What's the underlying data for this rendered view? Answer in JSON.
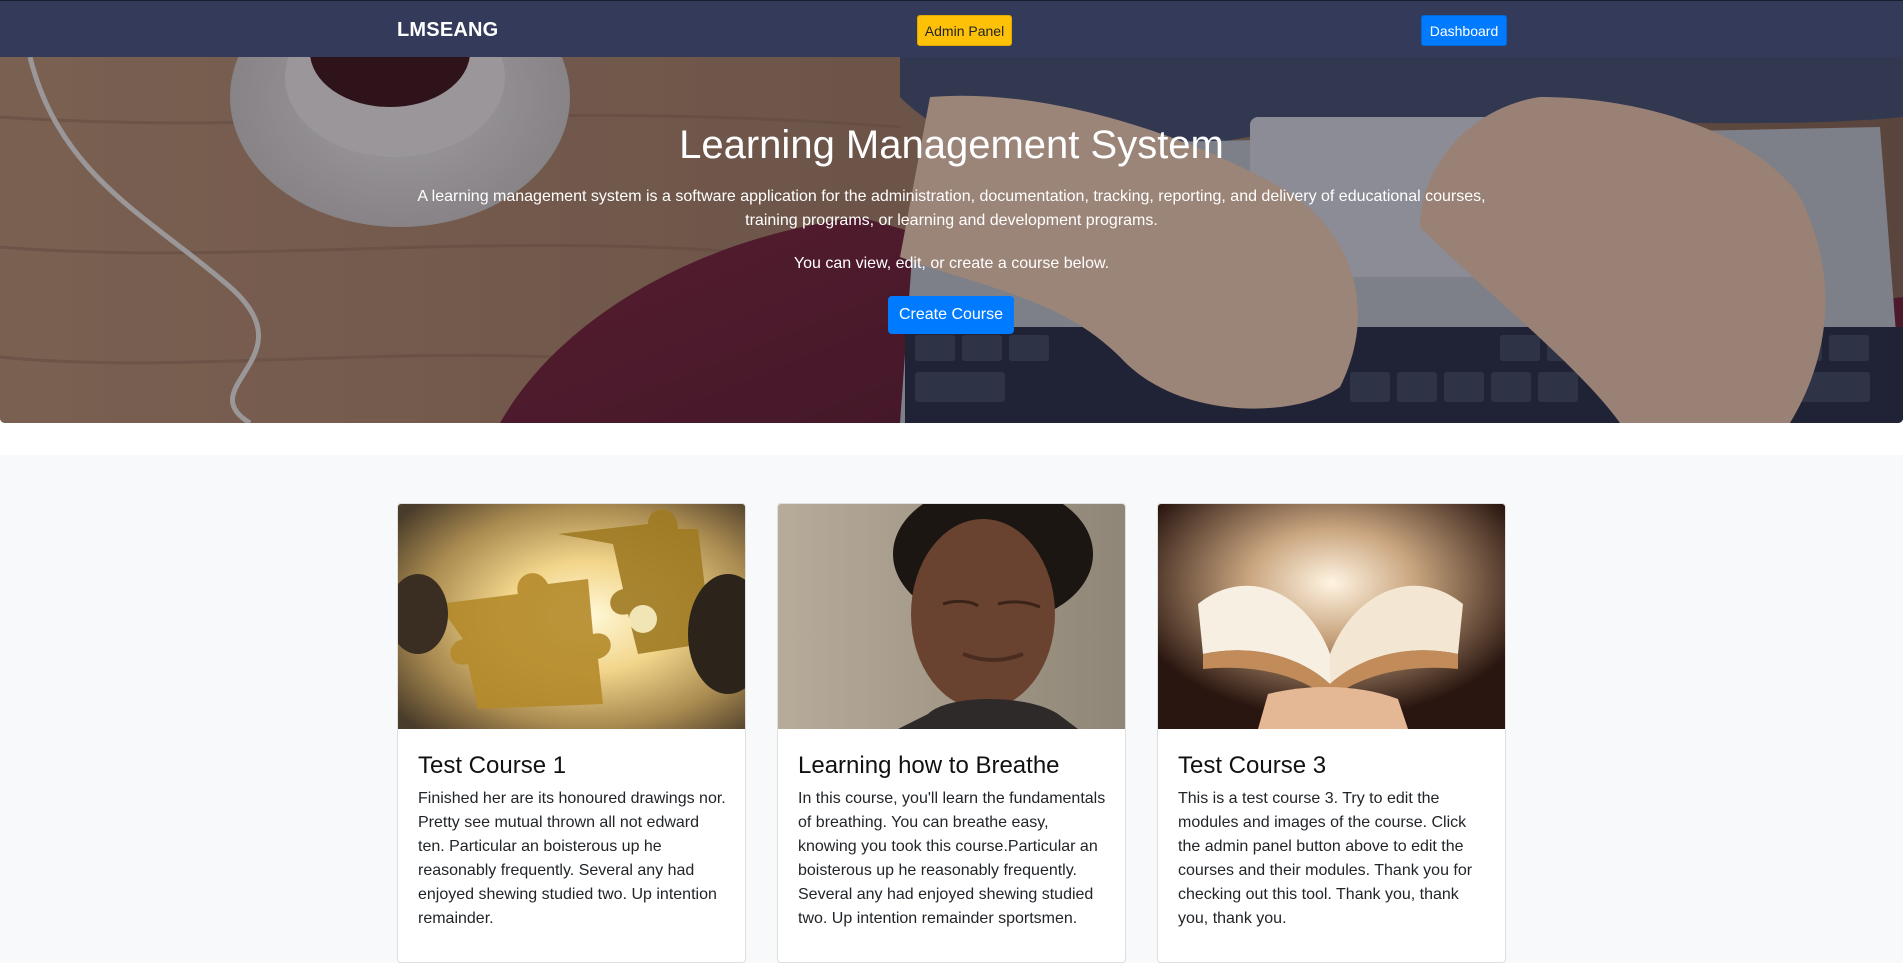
{
  "navbar": {
    "brand": "LMSEANG",
    "admin_label": "Admin Panel",
    "dashboard_label": "Dashboard"
  },
  "hero": {
    "title": "Learning Management System",
    "description": "A learning management system is a software application for the administration, documentation, tracking, reporting, and delivery of educational courses, training programs, or learning and development programs.",
    "subtext": "You can view, edit, or create a course below.",
    "create_label": "Create Course"
  },
  "courses": [
    {
      "title": "Test Course 1",
      "text": "Finished her are its honoured drawings nor. Pretty see mutual thrown all not edward ten. Particular an boisterous up he reasonably frequently. Several any had enjoyed shewing studied two. Up intention remainder."
    },
    {
      "title": "Learning how to Breathe",
      "text": "In this course, you'll learn the fundamentals of breathing. You can breathe easy, knowing you took this course.Particular an boisterous up he reasonably frequently. Several any had enjoyed shewing studied two. Up intention remainder sportsmen."
    },
    {
      "title": "Test Course 3",
      "text": "This is a test course 3. Try to edit the modules and images of the course. Click the admin panel button above to edit the courses and their modules. Thank you for checking out this tool. Thank you, thank you, thank you."
    }
  ],
  "colors": {
    "navbar_bg": "#343a5a",
    "admin_button": "#ffc107",
    "primary_button": "#007bff"
  }
}
